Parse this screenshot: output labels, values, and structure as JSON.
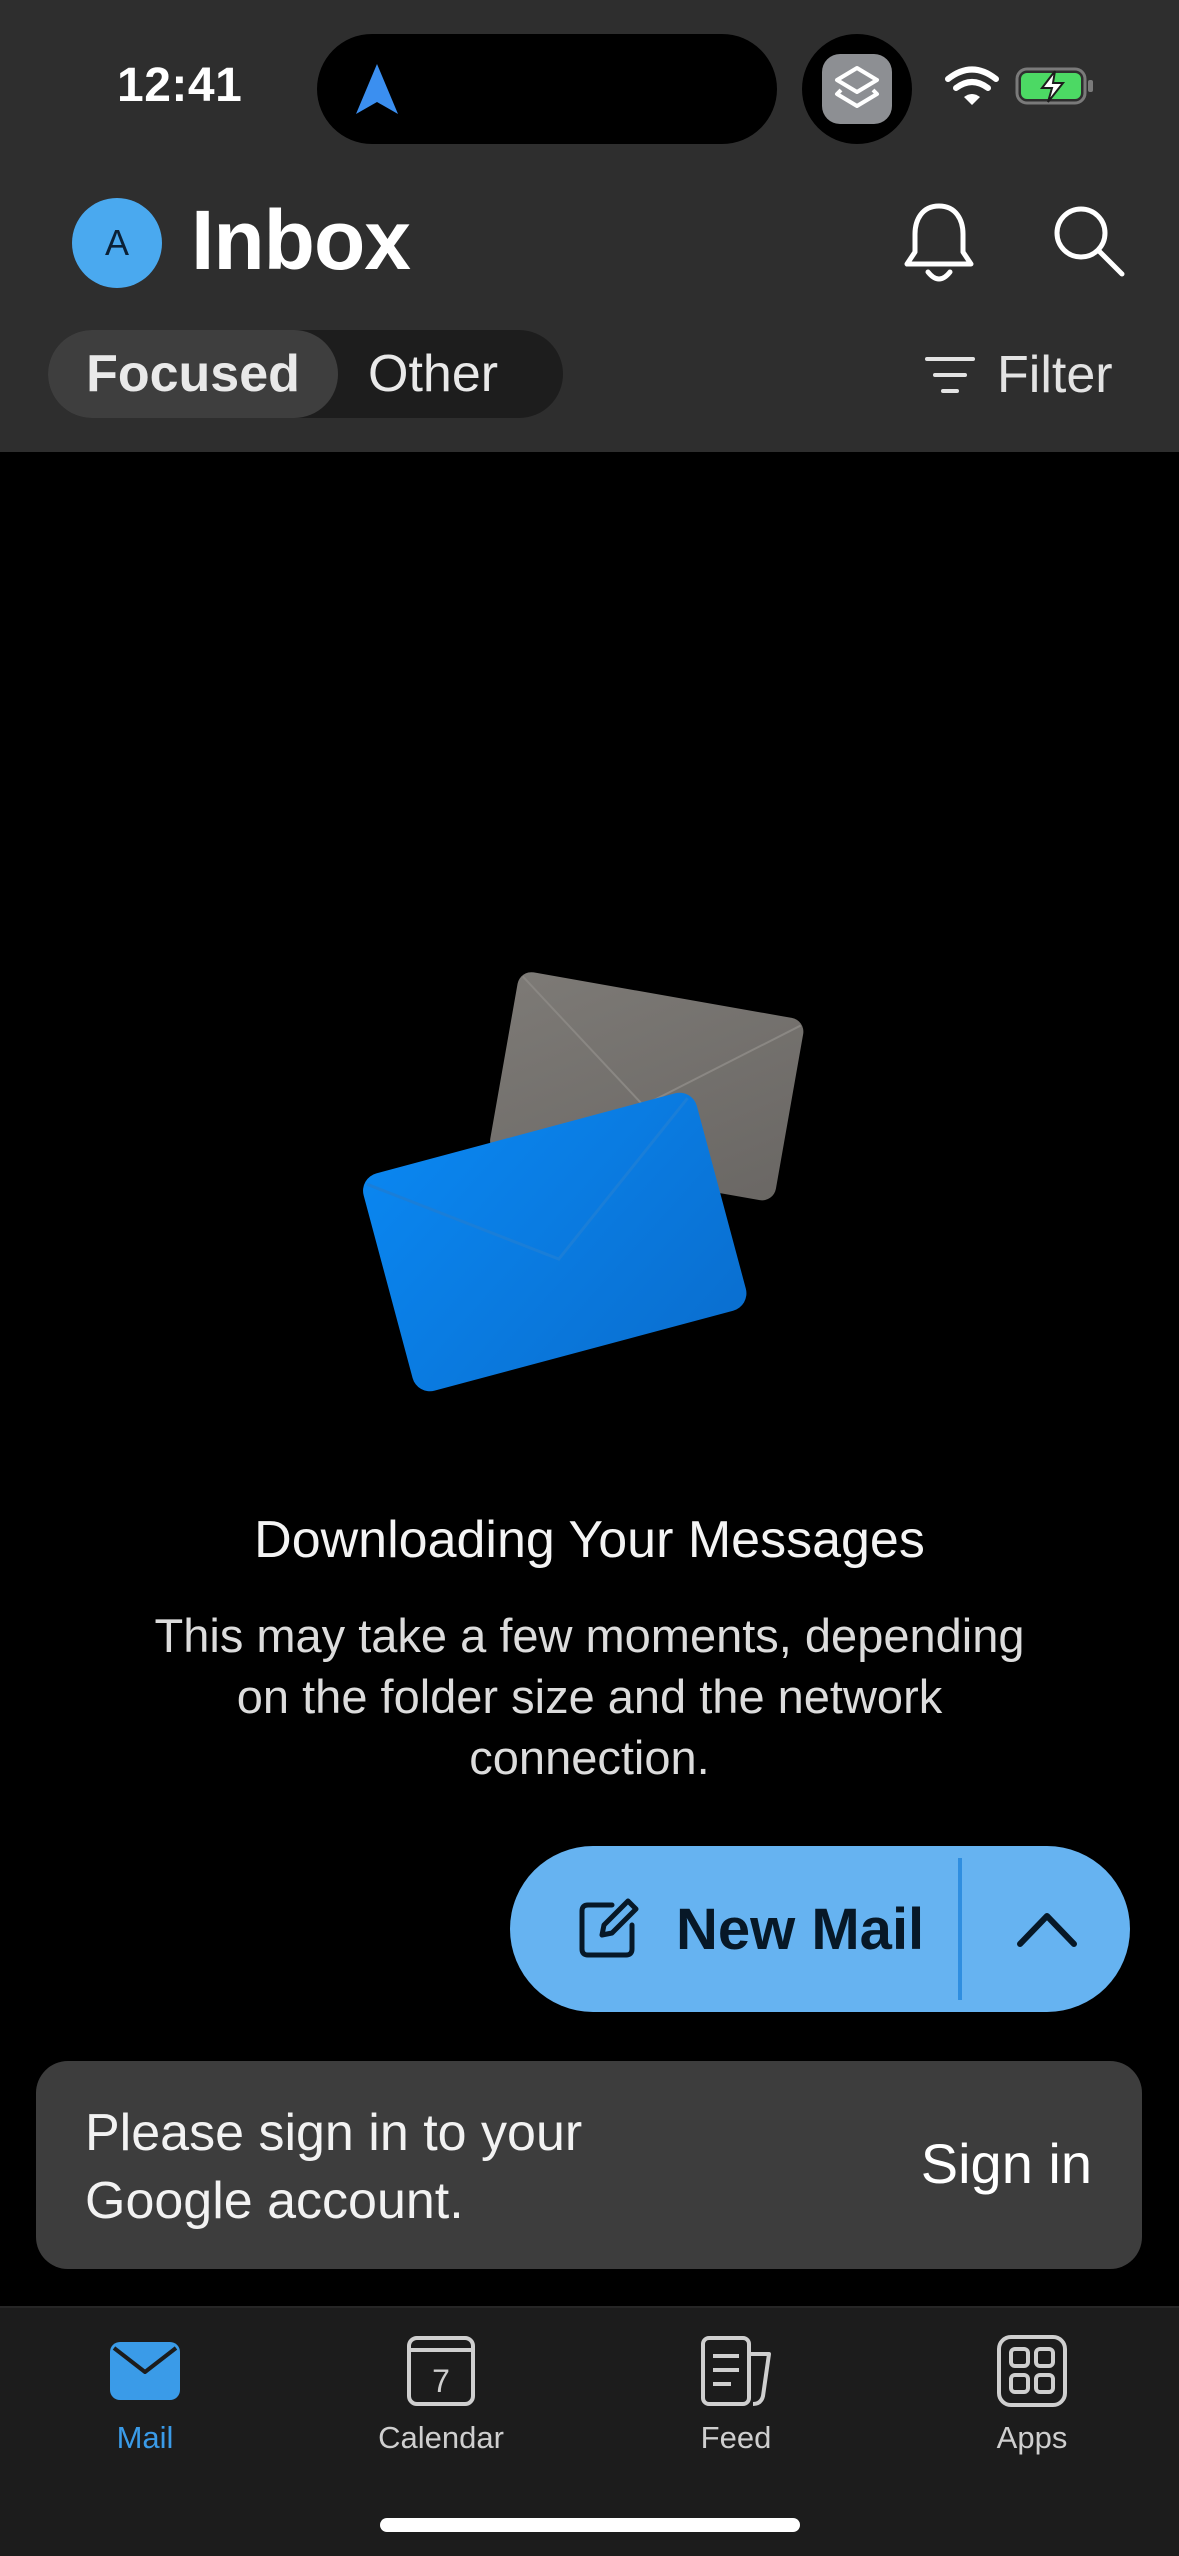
{
  "status_bar": {
    "time": "12:41"
  },
  "header": {
    "avatar_initial": "A",
    "title": "Inbox",
    "tabs": [
      {
        "label": "Focused",
        "selected": true
      },
      {
        "label": "Other",
        "selected": false
      }
    ],
    "filter_label": "Filter"
  },
  "empty_state": {
    "heading": "Downloading Your Messages",
    "body": "This may take a few moments, depending on the folder size and the network connection."
  },
  "compose": {
    "label": "New Mail"
  },
  "banner": {
    "message": "Please sign in to your Google account.",
    "action_label": "Sign in"
  },
  "tabbar": {
    "items": [
      {
        "label": "Mail",
        "icon": "mail-icon",
        "active": true
      },
      {
        "label": "Calendar",
        "icon": "calendar-icon",
        "active": false,
        "day": "7"
      },
      {
        "label": "Feed",
        "icon": "feed-icon",
        "active": false
      },
      {
        "label": "Apps",
        "icon": "apps-icon",
        "active": false
      }
    ]
  },
  "colors": {
    "accent": "#3a9be8",
    "compose_button": "#66b3f1",
    "header_bg": "#2e2e2e",
    "banner_bg": "#3d3d3d"
  }
}
